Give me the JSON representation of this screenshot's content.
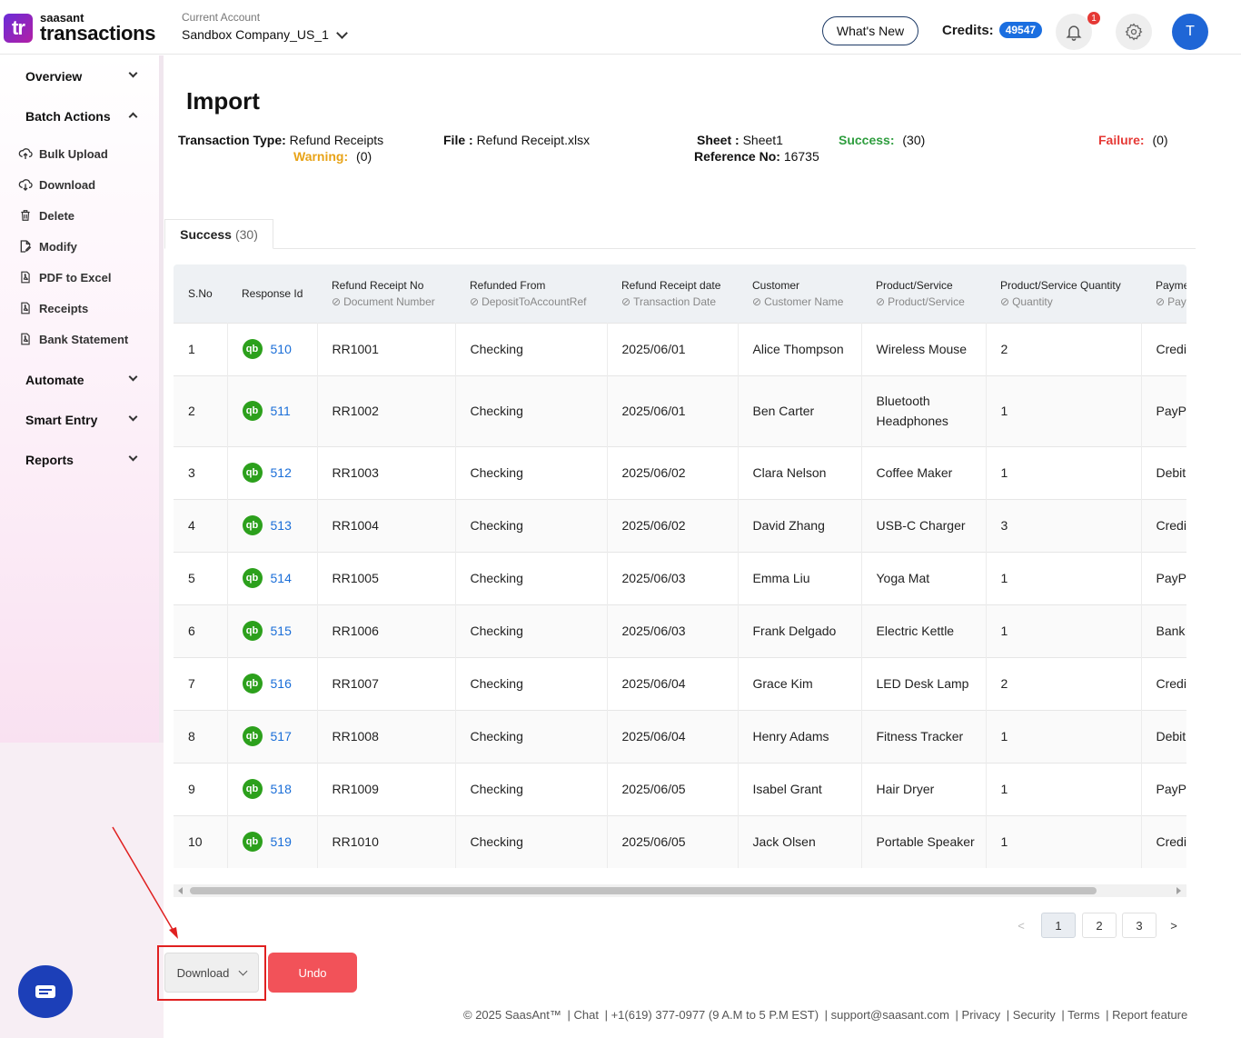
{
  "header": {
    "logo_small": "saasant",
    "logo_big": "transactions",
    "logo_mark": "tr",
    "account_label": "Current Account",
    "account_name": "Sandbox Company_US_1",
    "whats_new": "What's New",
    "credits_label": "Credits:",
    "credits_value": "49547",
    "notification_count": "1",
    "avatar_initial": "T",
    "icons": [
      "bell-icon",
      "gear-icon"
    ]
  },
  "sidebar": {
    "sections": [
      {
        "label": "Overview",
        "expanded": false
      },
      {
        "label": "Batch Actions",
        "expanded": true
      },
      {
        "label": "Automate",
        "expanded": false
      },
      {
        "label": "Smart Entry",
        "expanded": false
      },
      {
        "label": "Reports",
        "expanded": false
      }
    ],
    "batch_items": [
      {
        "label": "Bulk Upload",
        "icon": "cloud-upload-icon"
      },
      {
        "label": "Download",
        "icon": "cloud-download-icon"
      },
      {
        "label": "Delete",
        "icon": "trash-icon"
      },
      {
        "label": "Modify",
        "icon": "edit-file-icon"
      },
      {
        "label": "PDF to Excel",
        "icon": "pdf-icon"
      },
      {
        "label": "Receipts",
        "icon": "pdf-icon"
      },
      {
        "label": "Bank Statement",
        "icon": "pdf-icon"
      }
    ]
  },
  "main": {
    "title": "Import",
    "meta": {
      "transaction_type_label": "Transaction Type:",
      "transaction_type_value": "Refund Receipts",
      "warning_label": "Warning:",
      "warning_value": "(0)",
      "file_label": "File :",
      "file_value": "Refund Receipt.xlsx",
      "sheet_label": "Sheet :",
      "sheet_value": "Sheet1",
      "reference_label": "Reference No:",
      "reference_value": "16735",
      "success_label": "Success:",
      "success_value": "(30)",
      "failure_label": "Failure:",
      "failure_value": "(0)"
    },
    "tab": {
      "label": "Success",
      "count": "(30)"
    },
    "table": {
      "columns": [
        {
          "title": "S.No",
          "sub": ""
        },
        {
          "title": "Response Id",
          "sub": ""
        },
        {
          "title": "Refund Receipt No",
          "sub": "Document Number"
        },
        {
          "title": "Refunded From",
          "sub": "DepositToAccountRef"
        },
        {
          "title": "Refund Receipt date",
          "sub": "Transaction Date"
        },
        {
          "title": "Customer",
          "sub": "Customer Name"
        },
        {
          "title": "Product/Service",
          "sub": "Product/Service"
        },
        {
          "title": "Product/Service Quantity",
          "sub": "Quantity"
        },
        {
          "title": "Payme",
          "sub": "Pay"
        }
      ],
      "rows": [
        {
          "sno": "1",
          "resp": "510",
          "rr": "RR1001",
          "from": "Checking",
          "date": "2025/06/01",
          "customer": "Alice Thompson",
          "product": "Wireless Mouse",
          "qty": "2",
          "pay": "Credi"
        },
        {
          "sno": "2",
          "resp": "511",
          "rr": "RR1002",
          "from": "Checking",
          "date": "2025/06/01",
          "customer": "Ben Carter",
          "product": "Bluetooth Headphones",
          "qty": "1",
          "pay": "PayPa"
        },
        {
          "sno": "3",
          "resp": "512",
          "rr": "RR1003",
          "from": "Checking",
          "date": "2025/06/02",
          "customer": "Clara Nelson",
          "product": "Coffee Maker",
          "qty": "1",
          "pay": "Debit"
        },
        {
          "sno": "4",
          "resp": "513",
          "rr": "RR1004",
          "from": "Checking",
          "date": "2025/06/02",
          "customer": "David Zhang",
          "product": "USB-C Charger",
          "qty": "3",
          "pay": "Credi"
        },
        {
          "sno": "5",
          "resp": "514",
          "rr": "RR1005",
          "from": "Checking",
          "date": "2025/06/03",
          "customer": "Emma Liu",
          "product": "Yoga Mat",
          "qty": "1",
          "pay": "PayPa"
        },
        {
          "sno": "6",
          "resp": "515",
          "rr": "RR1006",
          "from": "Checking",
          "date": "2025/06/03",
          "customer": "Frank Delgado",
          "product": "Electric Kettle",
          "qty": "1",
          "pay": "Bank"
        },
        {
          "sno": "7",
          "resp": "516",
          "rr": "RR1007",
          "from": "Checking",
          "date": "2025/06/04",
          "customer": "Grace Kim",
          "product": "LED Desk Lamp",
          "qty": "2",
          "pay": "Credi"
        },
        {
          "sno": "8",
          "resp": "517",
          "rr": "RR1008",
          "from": "Checking",
          "date": "2025/06/04",
          "customer": "Henry Adams",
          "product": "Fitness Tracker",
          "qty": "1",
          "pay": "Debit"
        },
        {
          "sno": "9",
          "resp": "518",
          "rr": "RR1009",
          "from": "Checking",
          "date": "2025/06/05",
          "customer": "Isabel Grant",
          "product": "Hair Dryer",
          "qty": "1",
          "pay": "PayPa"
        },
        {
          "sno": "10",
          "resp": "519",
          "rr": "RR1010",
          "from": "Checking",
          "date": "2025/06/05",
          "customer": "Jack Olsen",
          "product": "Portable Speaker",
          "qty": "1",
          "pay": "Credi"
        }
      ]
    },
    "pagination": {
      "pages": [
        "1",
        "2",
        "3"
      ],
      "active": "1",
      "prev": "<",
      "next": ">"
    },
    "actions": {
      "download": "Download",
      "undo": "Undo"
    }
  },
  "footer": {
    "copyright": "© 2025 SaasAnt™",
    "chat": "| Chat",
    "phone": "| +1(619) 377-0977 (9 A.M to 5 P.M EST)",
    "email": "| support@saasant.com",
    "privacy": "| Privacy",
    "security": "| Security",
    "terms": "| Terms",
    "report": "| Report feature"
  },
  "colors": {
    "brand_gradient_start": "#6a2cd8",
    "credits_badge": "#1a6ee0",
    "success": "#2e9d3e",
    "warning": "#e8a317",
    "failure": "#e53935",
    "undo": "#f25259",
    "qb_green": "#2ca01c",
    "annotation_red": "#e02020"
  }
}
